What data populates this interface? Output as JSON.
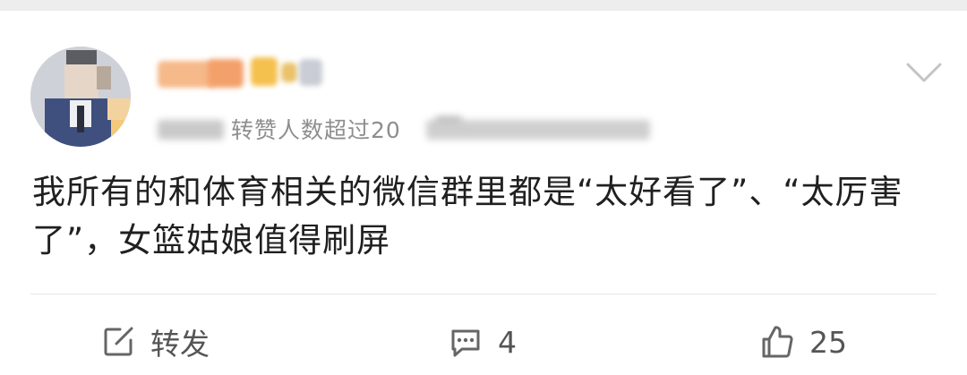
{
  "post": {
    "author": {
      "name_obscured": true,
      "avatar": "avatar-icon"
    },
    "meta_text": "转赞人数超过20",
    "content": "我所有的和体育相关的微信群里都是“太好看了”、“太厉害了”，女篮姑娘值得刷屏"
  },
  "actions": {
    "repost_label": "转发",
    "comment_count": "4",
    "like_count": "25"
  },
  "icons": {
    "menu": "chevron-down-icon",
    "repost": "share-edit-icon",
    "comment": "comment-icon",
    "like": "thumbs-up-icon"
  },
  "colors": {
    "background": "#ffffff",
    "top_strip": "#ededed",
    "text": "#202020",
    "meta": "#8e8e8e",
    "action": "#555555",
    "divider": "#e6e6e6"
  }
}
